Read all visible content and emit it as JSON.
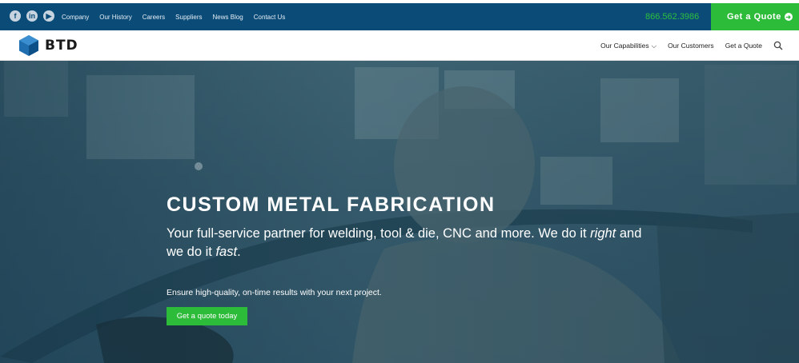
{
  "topbar": {
    "social": [
      {
        "name": "facebook-icon",
        "glyph": "f"
      },
      {
        "name": "linkedin-icon",
        "glyph": "in"
      },
      {
        "name": "youtube-icon",
        "glyph": "▶"
      }
    ],
    "links": [
      "Company",
      "Our History",
      "Careers",
      "Suppliers",
      "News Blog",
      "Contact Us"
    ],
    "phone": "866.562.3986",
    "quote_label": "Get a Quote",
    "quote_icon": "arrow-circle-right-icon",
    "background": "#0a4b78",
    "accent": "#2dbb3a"
  },
  "navbar": {
    "logo_text": "BTD",
    "logo_icon": "hexagon-cube-icon",
    "items": [
      "Our Capabilities",
      "Our Customers",
      "Get a Quote"
    ],
    "capabilities_has_dropdown": true,
    "search_icon": "search-icon"
  },
  "hero": {
    "title": "CUSTOM METAL FABRICATION",
    "subtitle_part1": "Your full-service partner for welding, tool & die, CNC and more. We do it ",
    "subtitle_em1": "right",
    "subtitle_part2": " and we do it ",
    "subtitle_em2": "fast",
    "subtitle_part3": ".",
    "tagline": "Ensure high-quality, on-time results with your next project.",
    "cta_label": "Get a quote today"
  }
}
